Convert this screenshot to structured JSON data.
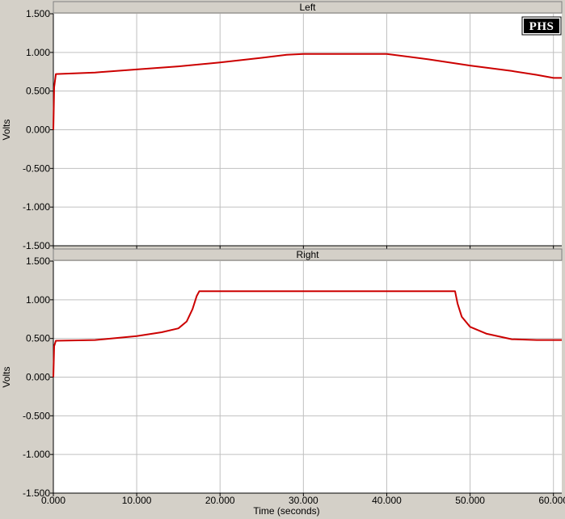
{
  "logo": {
    "text": "PHS"
  },
  "colors": {
    "line": "#cc0000",
    "grid": "#c0c0c0",
    "plot_bg": "#ffffff",
    "frame_bg": "#d4d0c8"
  },
  "chart_data": [
    {
      "type": "line",
      "title": "Left",
      "xlabel": "",
      "ylabel": "Volts",
      "xlim": [
        0,
        61
      ],
      "ylim": [
        -1.5,
        1.5
      ],
      "x_ticks": [
        0,
        10,
        20,
        30,
        40,
        50,
        60
      ],
      "x_tick_labels": [],
      "y_ticks": [
        -1.5,
        -1.0,
        -0.5,
        0.0,
        0.5,
        1.0,
        1.5
      ],
      "y_tick_labels": [
        "-1.500",
        "-1.000",
        "-0.500",
        "0.000",
        "0.500",
        "1.000",
        "1.500"
      ],
      "grid": true,
      "series": [
        {
          "x": [
            0,
            0.1,
            0.3,
            5,
            10,
            15,
            20,
            25,
            28,
            30,
            35,
            40,
            45,
            50,
            55,
            58,
            60,
            61
          ],
          "y": [
            0.0,
            0.55,
            0.72,
            0.74,
            0.78,
            0.82,
            0.87,
            0.93,
            0.97,
            0.98,
            0.98,
            0.98,
            0.91,
            0.83,
            0.76,
            0.71,
            0.67,
            0.67
          ]
        }
      ]
    },
    {
      "type": "line",
      "title": "Right",
      "xlabel": "Time (seconds)",
      "ylabel": "Volts",
      "xlim": [
        0,
        61
      ],
      "ylim": [
        -1.5,
        1.5
      ],
      "x_ticks": [
        0,
        10,
        20,
        30,
        40,
        50,
        60
      ],
      "x_tick_labels": [
        "0.000",
        "10.000",
        "20.000",
        "30.000",
        "40.000",
        "50.000",
        "60.000"
      ],
      "y_ticks": [
        -1.5,
        -1.0,
        -0.5,
        0.0,
        0.5,
        1.0,
        1.5
      ],
      "y_tick_labels": [
        "-1.500",
        "-1.000",
        "-0.500",
        "0.000",
        "0.500",
        "1.000",
        "1.500"
      ],
      "grid": true,
      "series": [
        {
          "x": [
            0,
            0.1,
            0.3,
            5,
            10,
            13,
            15,
            16,
            16.7,
            17.2,
            17.5,
            20,
            30,
            40,
            48.2,
            48.5,
            49,
            50,
            52,
            55,
            58,
            61
          ],
          "y": [
            0.0,
            0.4,
            0.47,
            0.48,
            0.53,
            0.58,
            0.63,
            0.72,
            0.88,
            1.05,
            1.11,
            1.11,
            1.11,
            1.11,
            1.11,
            0.95,
            0.78,
            0.65,
            0.56,
            0.49,
            0.48,
            0.48
          ]
        }
      ]
    }
  ]
}
